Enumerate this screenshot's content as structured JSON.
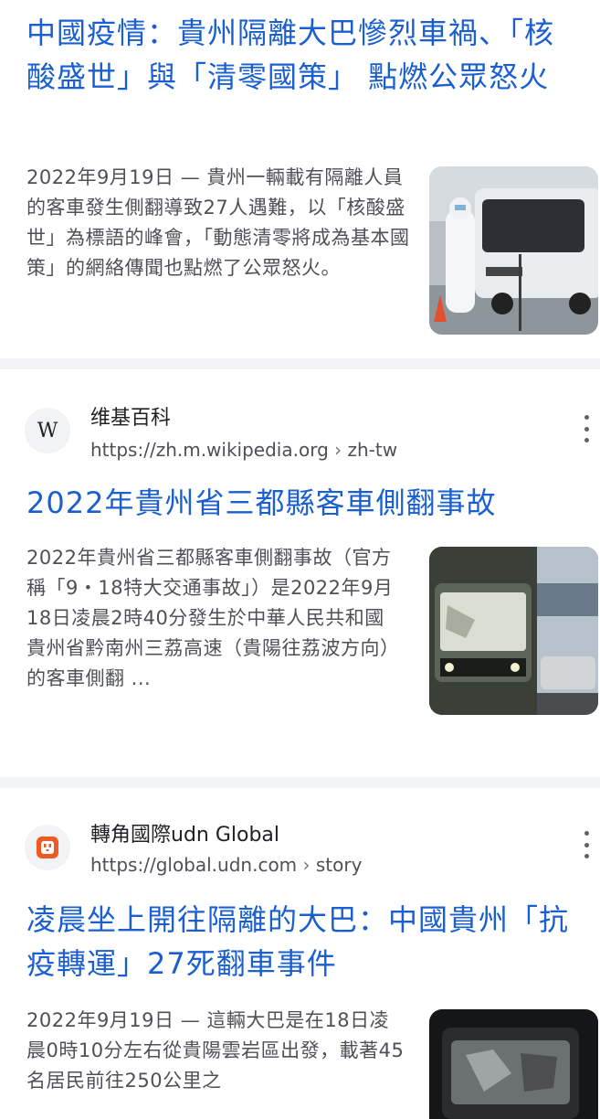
{
  "results": [
    {
      "title": "中國疫情：貴州隔離大巴慘烈車禍、「核酸盛世」與「清零國策」 點燃公眾怒火",
      "snippet_date": "2022年9月19日",
      "snippet_dash": " — ",
      "snippet_text": "貴州一輛載有隔離人員的客車發生側翻導致27人遇難，以「核酸盛世」為標語的峰會，「動態清零將成為基本國策」的網絡傳聞也點燃了公眾怒火。",
      "thumbnail_icon": "bus-hazmat-photo"
    },
    {
      "site_name": "维基百科",
      "site_url": "https://zh.m.wikipedia.org",
      "site_path": "zh-tw",
      "favicon_letter": "W",
      "title": "2022年貴州省三都縣客車側翻事故",
      "snippet_text": "2022年貴州省三都縣客車側翻事故（官方稱「9・18特大交通事故」）是2022年9月18日凌晨2時40分發生於中華人民共和國貴州省黔南州三荔高速（貴陽往荔波方向）的客車側翻 ...",
      "thumbnail_icon": "night-bus-photo"
    },
    {
      "site_name": "轉角國際udn Global",
      "site_url": "https://global.udn.com",
      "site_path": "story",
      "title": "凌晨坐上開往隔離的大巴：中國貴州「抗疫轉運」27死翻車事件",
      "snippet_date": "2022年9月19日",
      "snippet_dash": " — ",
      "snippet_text": "這輛大巴是在18日凌晨0時10分左右從貴陽雲岩區出發，載著45名居民前往250公里之",
      "thumbnail_icon": "dark-bus-photo"
    }
  ],
  "ui": {
    "path_separator": "›",
    "more_icon": "more-vert-icon"
  }
}
